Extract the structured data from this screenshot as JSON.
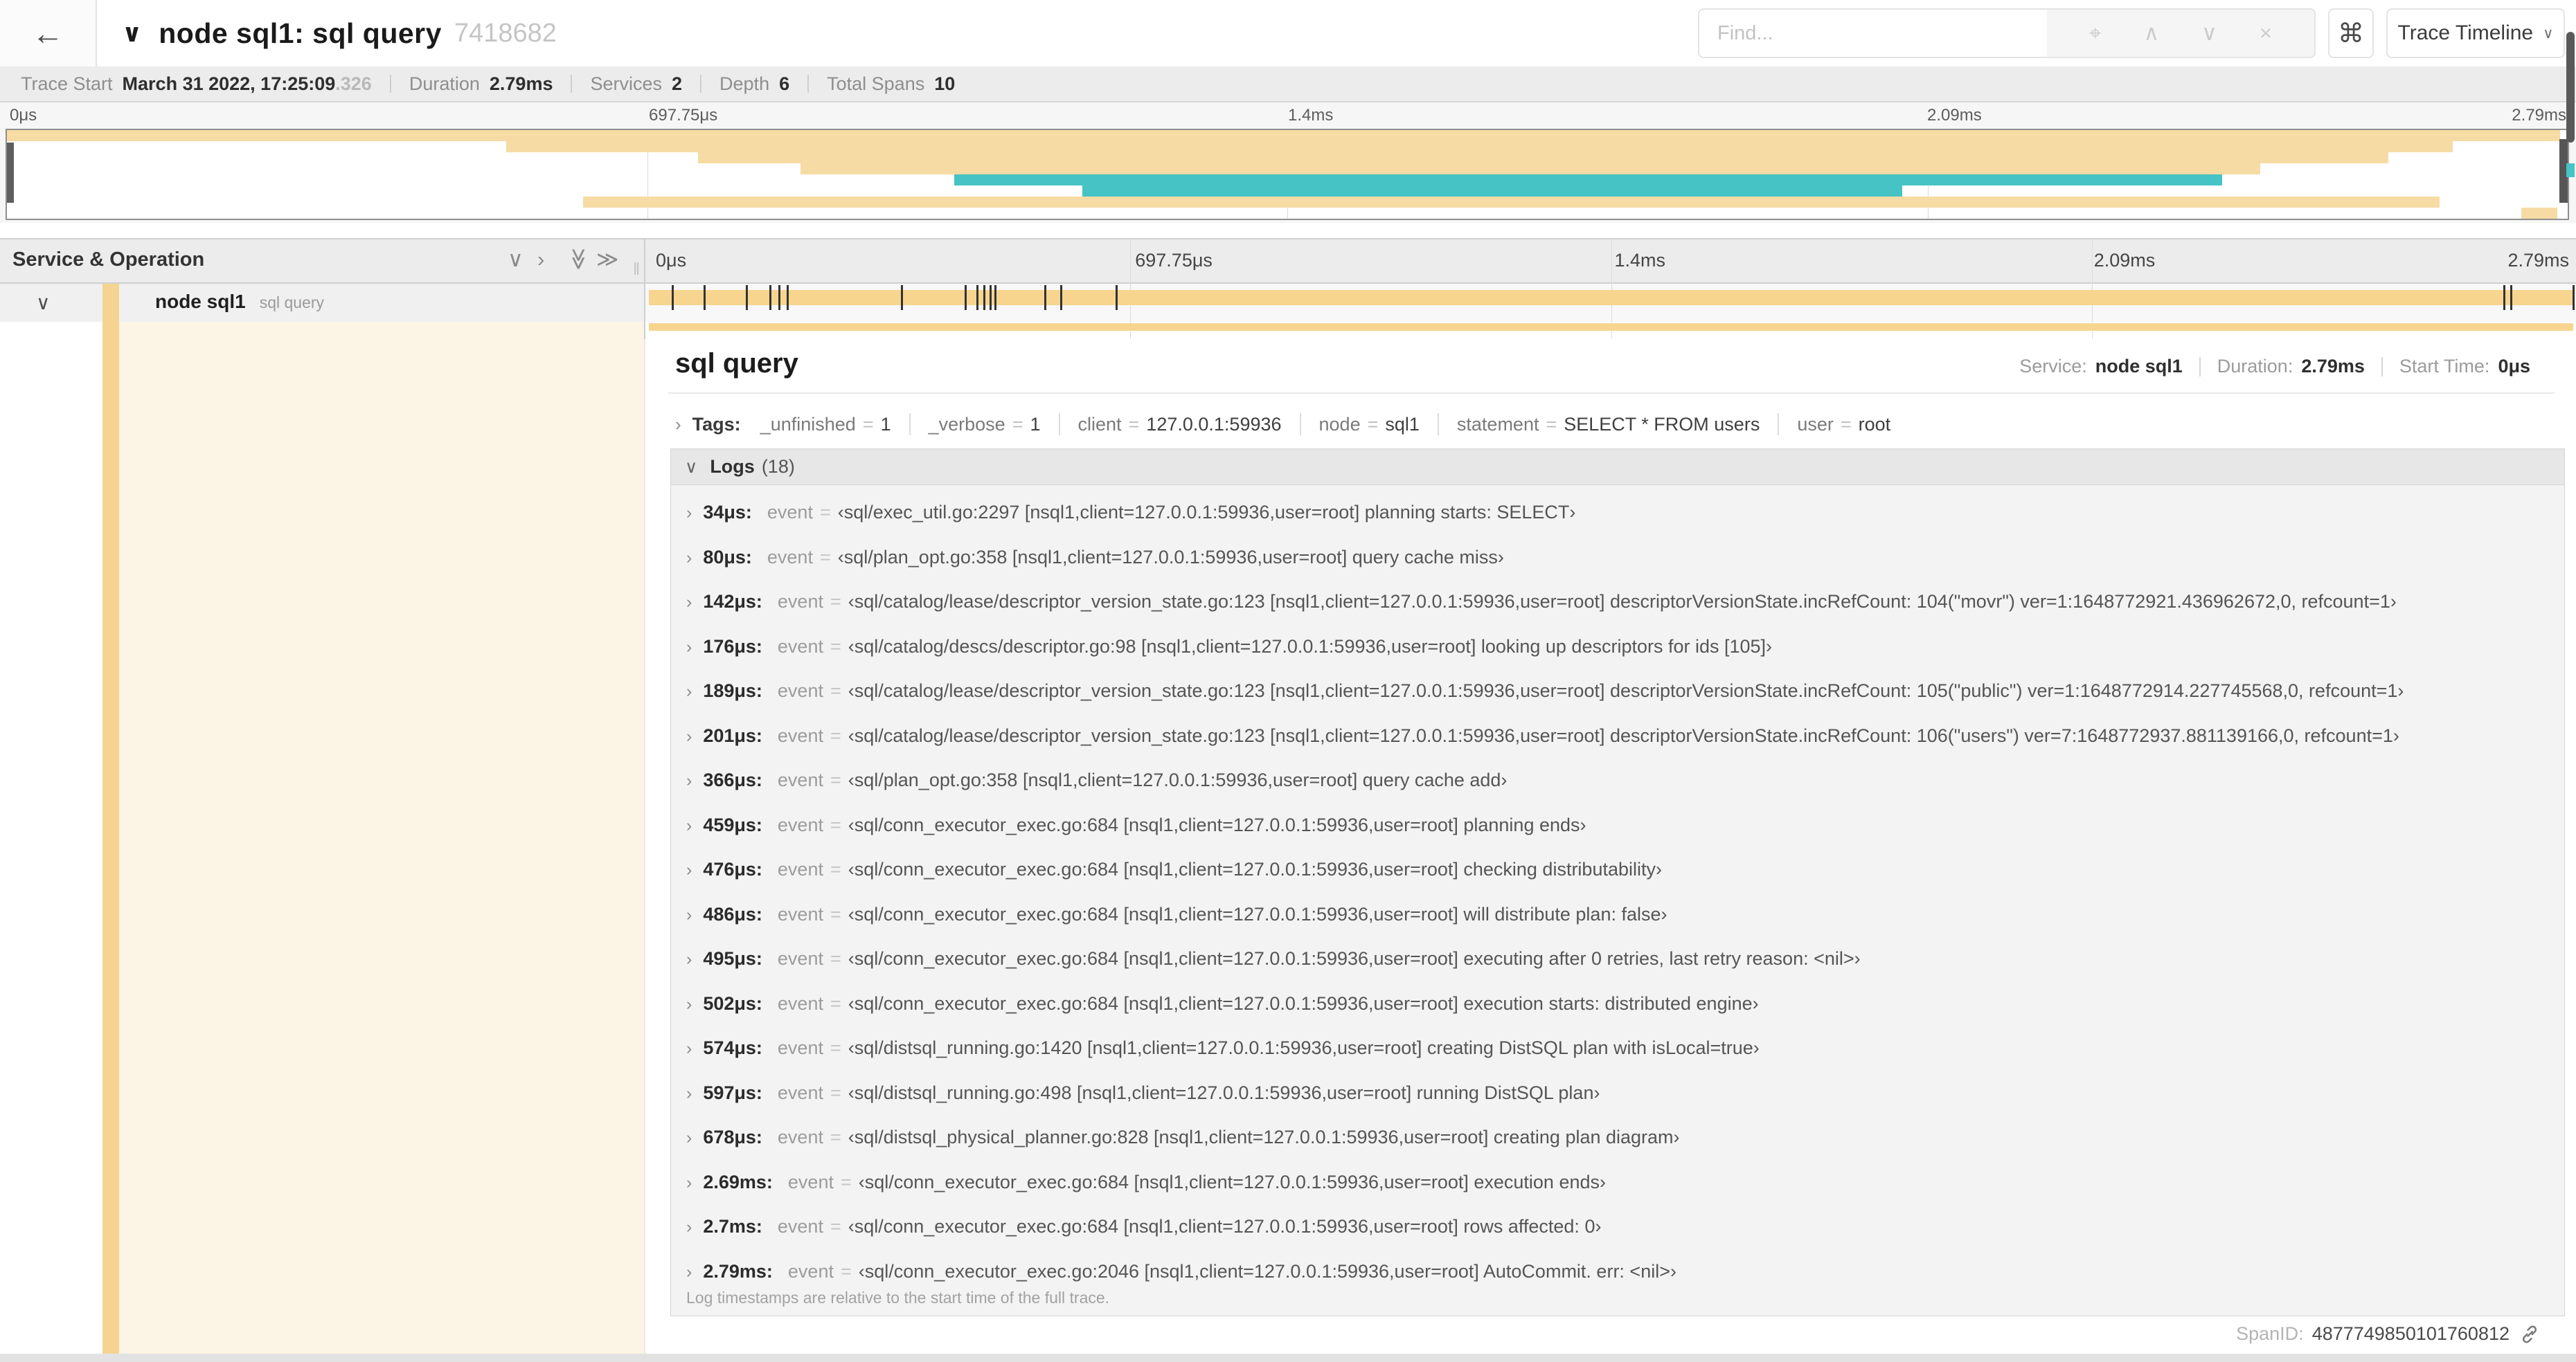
{
  "colors": {
    "span_yellow": "#F7D58F",
    "minimap_yellow": "#F6DCA4",
    "span_teal": "#46C3C5",
    "detail_cream": "#FCF5E5",
    "accent_yellow": "#F5D491"
  },
  "titlebar": {
    "back_icon": "←",
    "collapse_icon": "∨",
    "title": "node sql1: sql query",
    "trace_id": "7418682",
    "find": {
      "placeholder": "Find...",
      "icons": [
        "⌖",
        "∧",
        "∨",
        "×"
      ]
    },
    "shortcut_icon": "⌘",
    "view_select": {
      "label": "Trace Timeline",
      "chevron": "∨"
    }
  },
  "summary": {
    "items": [
      {
        "label": "Trace Start",
        "value": "March 31 2022, 17:25:09",
        "suffix": ".326"
      },
      {
        "label": "Duration",
        "value": "2.79ms"
      },
      {
        "label": "Services",
        "value": "2"
      },
      {
        "label": "Depth",
        "value": "6"
      },
      {
        "label": "Total Spans",
        "value": "10"
      }
    ]
  },
  "timeline": {
    "duration_us": 2790,
    "ticks": [
      {
        "label": "0μs",
        "pct": 0
      },
      {
        "label": "697.75μs",
        "pct": 25
      },
      {
        "label": "1.4ms",
        "pct": 50
      },
      {
        "label": "2.09ms",
        "pct": 75
      },
      {
        "label": "2.79ms",
        "pct": 100
      }
    ]
  },
  "minimap": {
    "rows": [
      {
        "color": "yellow",
        "start_pct": 0,
        "end_pct": 99.7
      },
      {
        "color": "yellow",
        "start_pct": 19.5,
        "end_pct": 95.5
      },
      {
        "color": "yellow",
        "start_pct": 27,
        "end_pct": 93
      },
      {
        "color": "yellow",
        "start_pct": 31,
        "end_pct": 88
      },
      {
        "color": "teal",
        "start_pct": 37,
        "end_pct": 86.5
      },
      {
        "color": "teal",
        "start_pct": 42,
        "end_pct": 74
      },
      {
        "color": "yellow",
        "start_pct": 22.5,
        "end_pct": 95
      },
      {
        "color": "yellow",
        "start_pct": 98.2,
        "end_pct": 99.6
      }
    ]
  },
  "tree_header": {
    "title": "Service & Operation",
    "collapse_buttons": [
      {
        "glyph": "∨",
        "name": "collapse-one-icon",
        "rotate": false
      },
      {
        "glyph": "›",
        "name": "expand-one-icon",
        "rotate": false
      },
      {
        "glyph": "≫",
        "name": "collapse-all-icon",
        "rotate": true
      },
      {
        "glyph": "≫",
        "name": "expand-all-icon",
        "rotate": false
      }
    ]
  },
  "span_row": {
    "expander": "∨",
    "service": "node sql1",
    "operation": "sql query",
    "log_marks_us": [
      34,
      80,
      142,
      176,
      189,
      201,
      366,
      459,
      476,
      486,
      495,
      502,
      574,
      597,
      678,
      2690,
      2700,
      2790
    ]
  },
  "detail": {
    "operation": "sql query",
    "meta": [
      {
        "label": "Service:",
        "value": "node sql1"
      },
      {
        "label": "Duration:",
        "value": "2.79ms"
      },
      {
        "label": "Start Time:",
        "value": "0μs"
      }
    ],
    "tags": {
      "expander": "›",
      "label": "Tags:",
      "items": [
        {
          "key": "_unfinished",
          "value": "1"
        },
        {
          "key": "_verbose",
          "value": "1"
        },
        {
          "key": "client",
          "value": "127.0.0.1:59936"
        },
        {
          "key": "node",
          "value": "sql1"
        },
        {
          "key": "statement",
          "value": "SELECT * FROM users"
        },
        {
          "key": "user",
          "value": "root"
        }
      ]
    },
    "logs": {
      "expander": "∨",
      "label": "Logs",
      "count": "(18)",
      "row_expander": "›",
      "field": "event",
      "entries": [
        {
          "time": "34μs:",
          "value": "‹sql/exec_util.go:2297 [nsql1,client=127.0.0.1:59936,user=root] planning starts: SELECT›"
        },
        {
          "time": "80μs:",
          "value": "‹sql/plan_opt.go:358 [nsql1,client=127.0.0.1:59936,user=root] query cache miss›"
        },
        {
          "time": "142μs:",
          "value": "‹sql/catalog/lease/descriptor_version_state.go:123 [nsql1,client=127.0.0.1:59936,user=root] descriptorVersionState.incRefCount: 104(\"movr\") ver=1:1648772921.436962672,0, refcount=1›"
        },
        {
          "time": "176μs:",
          "value": "‹sql/catalog/descs/descriptor.go:98 [nsql1,client=127.0.0.1:59936,user=root] looking up descriptors for ids [105]›"
        },
        {
          "time": "189μs:",
          "value": "‹sql/catalog/lease/descriptor_version_state.go:123 [nsql1,client=127.0.0.1:59936,user=root] descriptorVersionState.incRefCount: 105(\"public\") ver=1:1648772914.227745568,0, refcount=1›"
        },
        {
          "time": "201μs:",
          "value": "‹sql/catalog/lease/descriptor_version_state.go:123 [nsql1,client=127.0.0.1:59936,user=root] descriptorVersionState.incRefCount: 106(\"users\") ver=7:1648772937.881139166,0, refcount=1›"
        },
        {
          "time": "366μs:",
          "value": "‹sql/plan_opt.go:358 [nsql1,client=127.0.0.1:59936,user=root] query cache add›"
        },
        {
          "time": "459μs:",
          "value": "‹sql/conn_executor_exec.go:684 [nsql1,client=127.0.0.1:59936,user=root] planning ends›"
        },
        {
          "time": "476μs:",
          "value": "‹sql/conn_executor_exec.go:684 [nsql1,client=127.0.0.1:59936,user=root] checking distributability›"
        },
        {
          "time": "486μs:",
          "value": "‹sql/conn_executor_exec.go:684 [nsql1,client=127.0.0.1:59936,user=root] will distribute plan: false›"
        },
        {
          "time": "495μs:",
          "value": "‹sql/conn_executor_exec.go:684 [nsql1,client=127.0.0.1:59936,user=root] executing after 0 retries, last retry reason: <nil>›"
        },
        {
          "time": "502μs:",
          "value": "‹sql/conn_executor_exec.go:684 [nsql1,client=127.0.0.1:59936,user=root] execution starts: distributed engine›"
        },
        {
          "time": "574μs:",
          "value": "‹sql/distsql_running.go:1420 [nsql1,client=127.0.0.1:59936,user=root] creating DistSQL plan with isLocal=true›"
        },
        {
          "time": "597μs:",
          "value": "‹sql/distsql_running.go:498 [nsql1,client=127.0.0.1:59936,user=root] running DistSQL plan›"
        },
        {
          "time": "678μs:",
          "value": "‹sql/distsql_physical_planner.go:828 [nsql1,client=127.0.0.1:59936,user=root] creating plan diagram›"
        },
        {
          "time": "2.69ms:",
          "value": "‹sql/conn_executor_exec.go:684 [nsql1,client=127.0.0.1:59936,user=root] execution ends›"
        },
        {
          "time": "2.7ms:",
          "value": "‹sql/conn_executor_exec.go:684 [nsql1,client=127.0.0.1:59936,user=root] rows affected: 0›"
        },
        {
          "time": "2.79ms:",
          "value": "‹sql/conn_executor_exec.go:2046 [nsql1,client=127.0.0.1:59936,user=root] AutoCommit. err: <nil>›"
        }
      ],
      "footer": "Log timestamps are relative to the start time of the full trace."
    },
    "span_id_label": "SpanID:",
    "span_id": "4877749850101760812"
  }
}
